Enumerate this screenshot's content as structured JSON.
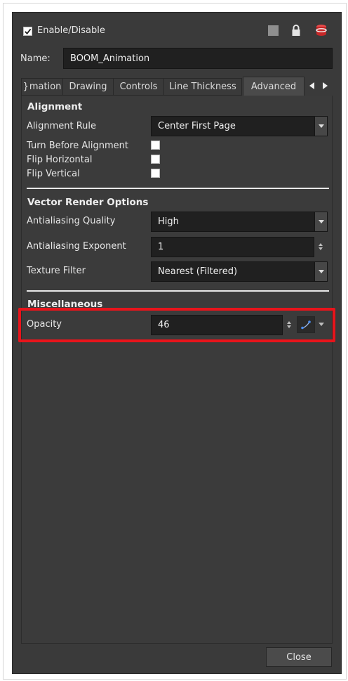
{
  "header": {
    "enable_label": "Enable/Disable",
    "icons": [
      "color-swatch-icon",
      "lock-icon",
      "layer-stack-icon"
    ]
  },
  "name": {
    "label": "Name:",
    "value": "BOOM_Animation"
  },
  "tabs": [
    {
      "label": "mation",
      "active": false
    },
    {
      "label": "Drawing",
      "active": false
    },
    {
      "label": "Controls",
      "active": false
    },
    {
      "label": "Line Thickness",
      "active": false
    },
    {
      "label": "Advanced",
      "active": true
    }
  ],
  "alignment": {
    "title": "Alignment",
    "rule_label": "Alignment Rule",
    "rule_value": "Center First Page",
    "turn_label": "Turn Before Alignment",
    "flip_h_label": "Flip Horizontal",
    "flip_v_label": "Flip Vertical"
  },
  "vector": {
    "title": "Vector Render Options",
    "aa_quality_label": "Antialiasing Quality",
    "aa_quality_value": "High",
    "aa_exponent_label": "Antialiasing Exponent",
    "aa_exponent_value": "1",
    "texture_label": "Texture Filter",
    "texture_value": "Nearest (Filtered)"
  },
  "misc": {
    "title": "Miscellaneous",
    "opacity_label": "Opacity",
    "opacity_value": "46"
  },
  "footer": {
    "close_label": "Close"
  },
  "colors": {
    "highlight": "#e8141b",
    "panel": "#3a3a3a",
    "field": "#202020"
  }
}
